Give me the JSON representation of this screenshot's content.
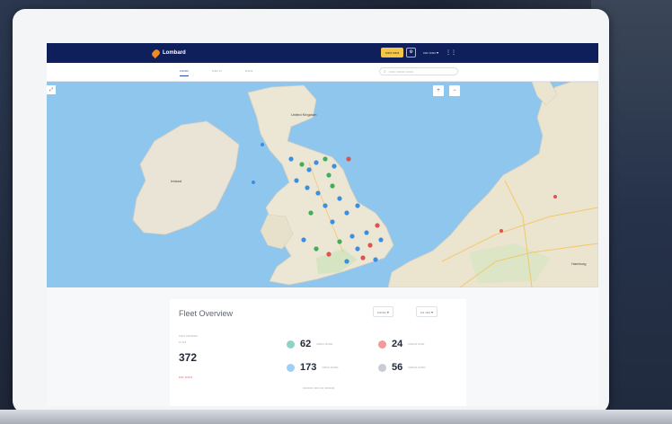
{
  "header": {
    "brand": "Lombard",
    "chip_label": "••••• •••••",
    "user_label": "•••• ••••• ▾",
    "grid_glyph": "⋮⋮"
  },
  "tabs": [
    "•••••••",
    "••••• ••",
    "••••••"
  ],
  "search": {
    "placeholder": "••••• ••••••• ••••••"
  },
  "map": {
    "labels": {
      "kingdom": "United Kingdom",
      "ireland": "Ireland",
      "hamburg": "Hamburg"
    },
    "zoom_in": "+",
    "zoom_out": "−",
    "corner": "⤢",
    "marker_colors": {
      "blue": "#3b8fe0",
      "green": "#3fae5a",
      "red": "#e0524f"
    }
  },
  "fleet": {
    "title": "Fleet Overview",
    "filter_1": "••••••• ▾",
    "filter_2": "••• •••• ▾",
    "total_label": "••••• •••••••••",
    "total_sub": "•• •••",
    "total_value": "372",
    "total_link": "•••• ••••••",
    "stats": [
      {
        "value": "62",
        "label": "••••••• •••••••",
        "color": "#8fd3c6"
      },
      {
        "value": "24",
        "label": "•••••••• ••••••",
        "color": "#f29a94"
      },
      {
        "value": "173",
        "label": "••••••• •••••••",
        "color": "#9fcff2"
      },
      {
        "value": "56",
        "label": "•••••••• •••••••",
        "color": "#c8ccd4"
      }
    ],
    "footnote": "•••••••• •••• ••• ••••••••"
  }
}
